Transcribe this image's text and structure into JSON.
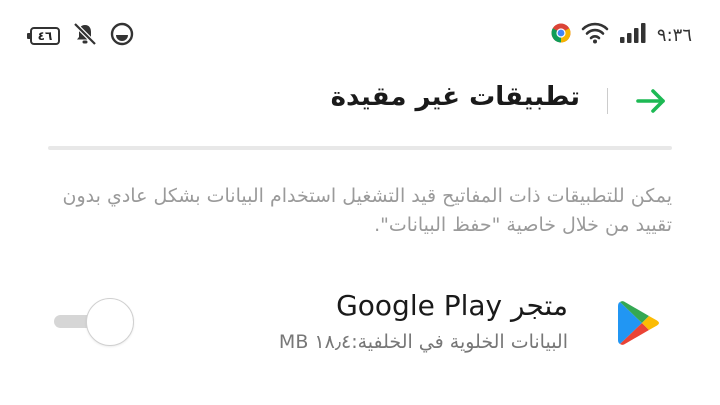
{
  "status_bar": {
    "time": "٩:٣٦",
    "battery_level": "٤٦",
    "left_icons": [
      "battery-icon",
      "notifications-muted-icon",
      "focus-mode-icon"
    ],
    "right_icons": [
      "chrome-icon",
      "wifi-icon",
      "signal-icon"
    ]
  },
  "header": {
    "title": "تطبيقات غير مقيدة",
    "back_icon": "back-arrow-icon"
  },
  "description": "يمكن للتطبيقات ذات المفاتيح قيد التشغيل استخدام البيانات بشكل عادي بدون تقييد من خلال خاصية \"حفظ البيانات\".",
  "apps": [
    {
      "name": "متجر Google Play",
      "usage": "البيانات الخلوية في الخلفية:١٨٫٤ MB",
      "icon": "google-play-icon",
      "unrestricted": false
    }
  ],
  "colors": {
    "accent": "#1db954",
    "text_primary": "#1a1a1a",
    "text_secondary": "#9a9a9a",
    "toggle_track_off": "#d6d6d6"
  }
}
